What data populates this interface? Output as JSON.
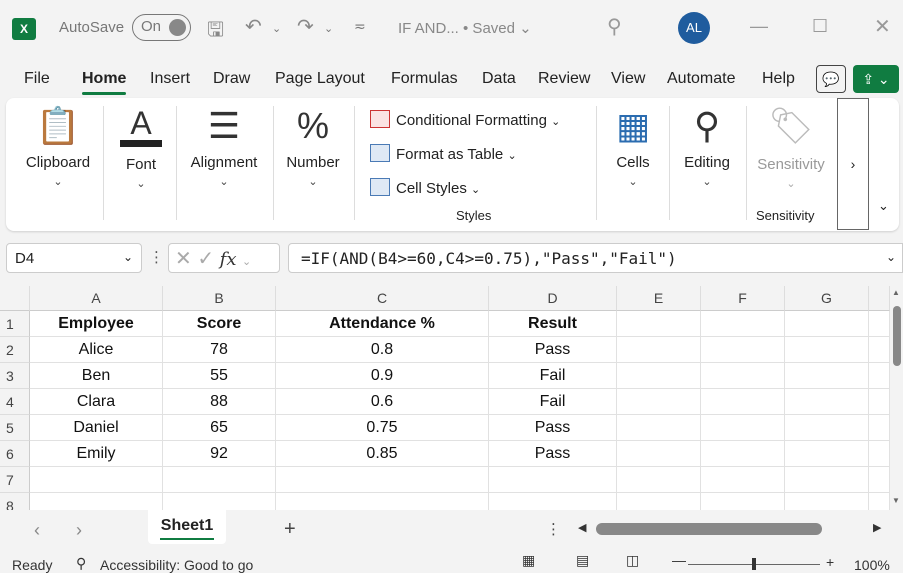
{
  "title_bar": {
    "autosave_label": "AutoSave",
    "autosave_state": "On",
    "doc_title": "IF AND...",
    "saved_status": "• Saved",
    "avatar_initials": "AL"
  },
  "menu": [
    "File",
    "Home",
    "Insert",
    "Draw",
    "Page Layout",
    "Formulas",
    "Data",
    "Review",
    "View",
    "Automate",
    "Help"
  ],
  "ribbon": {
    "clipboard": "Clipboard",
    "font": "Font",
    "alignment": "Alignment",
    "number": "Number",
    "conditional_formatting": "Conditional Formatting",
    "format_as_table": "Format as Table",
    "cell_styles": "Cell Styles",
    "styles_group": "Styles",
    "cells": "Cells",
    "editing": "Editing",
    "sensitivity_btn": "Sensitivity",
    "sensitivity_group": "Sensitivity"
  },
  "formula_bar": {
    "name_box": "D4",
    "fx": "fx",
    "formula": "=IF(AND(B4>=60,C4>=0.75),\"Pass\",\"Fail\")"
  },
  "grid": {
    "columns": [
      "A",
      "B",
      "C",
      "D",
      "E",
      "F",
      "G"
    ],
    "rows": [
      "1",
      "2",
      "3",
      "4",
      "5",
      "6",
      "7",
      "8"
    ],
    "header_row": [
      "Employee",
      "Score",
      "Attendance %",
      "Result"
    ],
    "data": [
      [
        "Alice",
        "78",
        "0.8",
        "Pass"
      ],
      [
        "Ben",
        "55",
        "0.9",
        "Fail"
      ],
      [
        "Clara",
        "88",
        "0.6",
        "Fail"
      ],
      [
        "Daniel",
        "65",
        "0.75",
        "Pass"
      ],
      [
        "Emily",
        "92",
        "0.85",
        "Pass"
      ]
    ]
  },
  "sheets": {
    "active": "Sheet1",
    "add": "+"
  },
  "status": {
    "ready": "Ready",
    "accessibility": "Accessibility: Good to go",
    "zoom": "100%"
  },
  "colors": {
    "excel_green": "#107c41",
    "avatar_blue": "#1f5c9e"
  }
}
